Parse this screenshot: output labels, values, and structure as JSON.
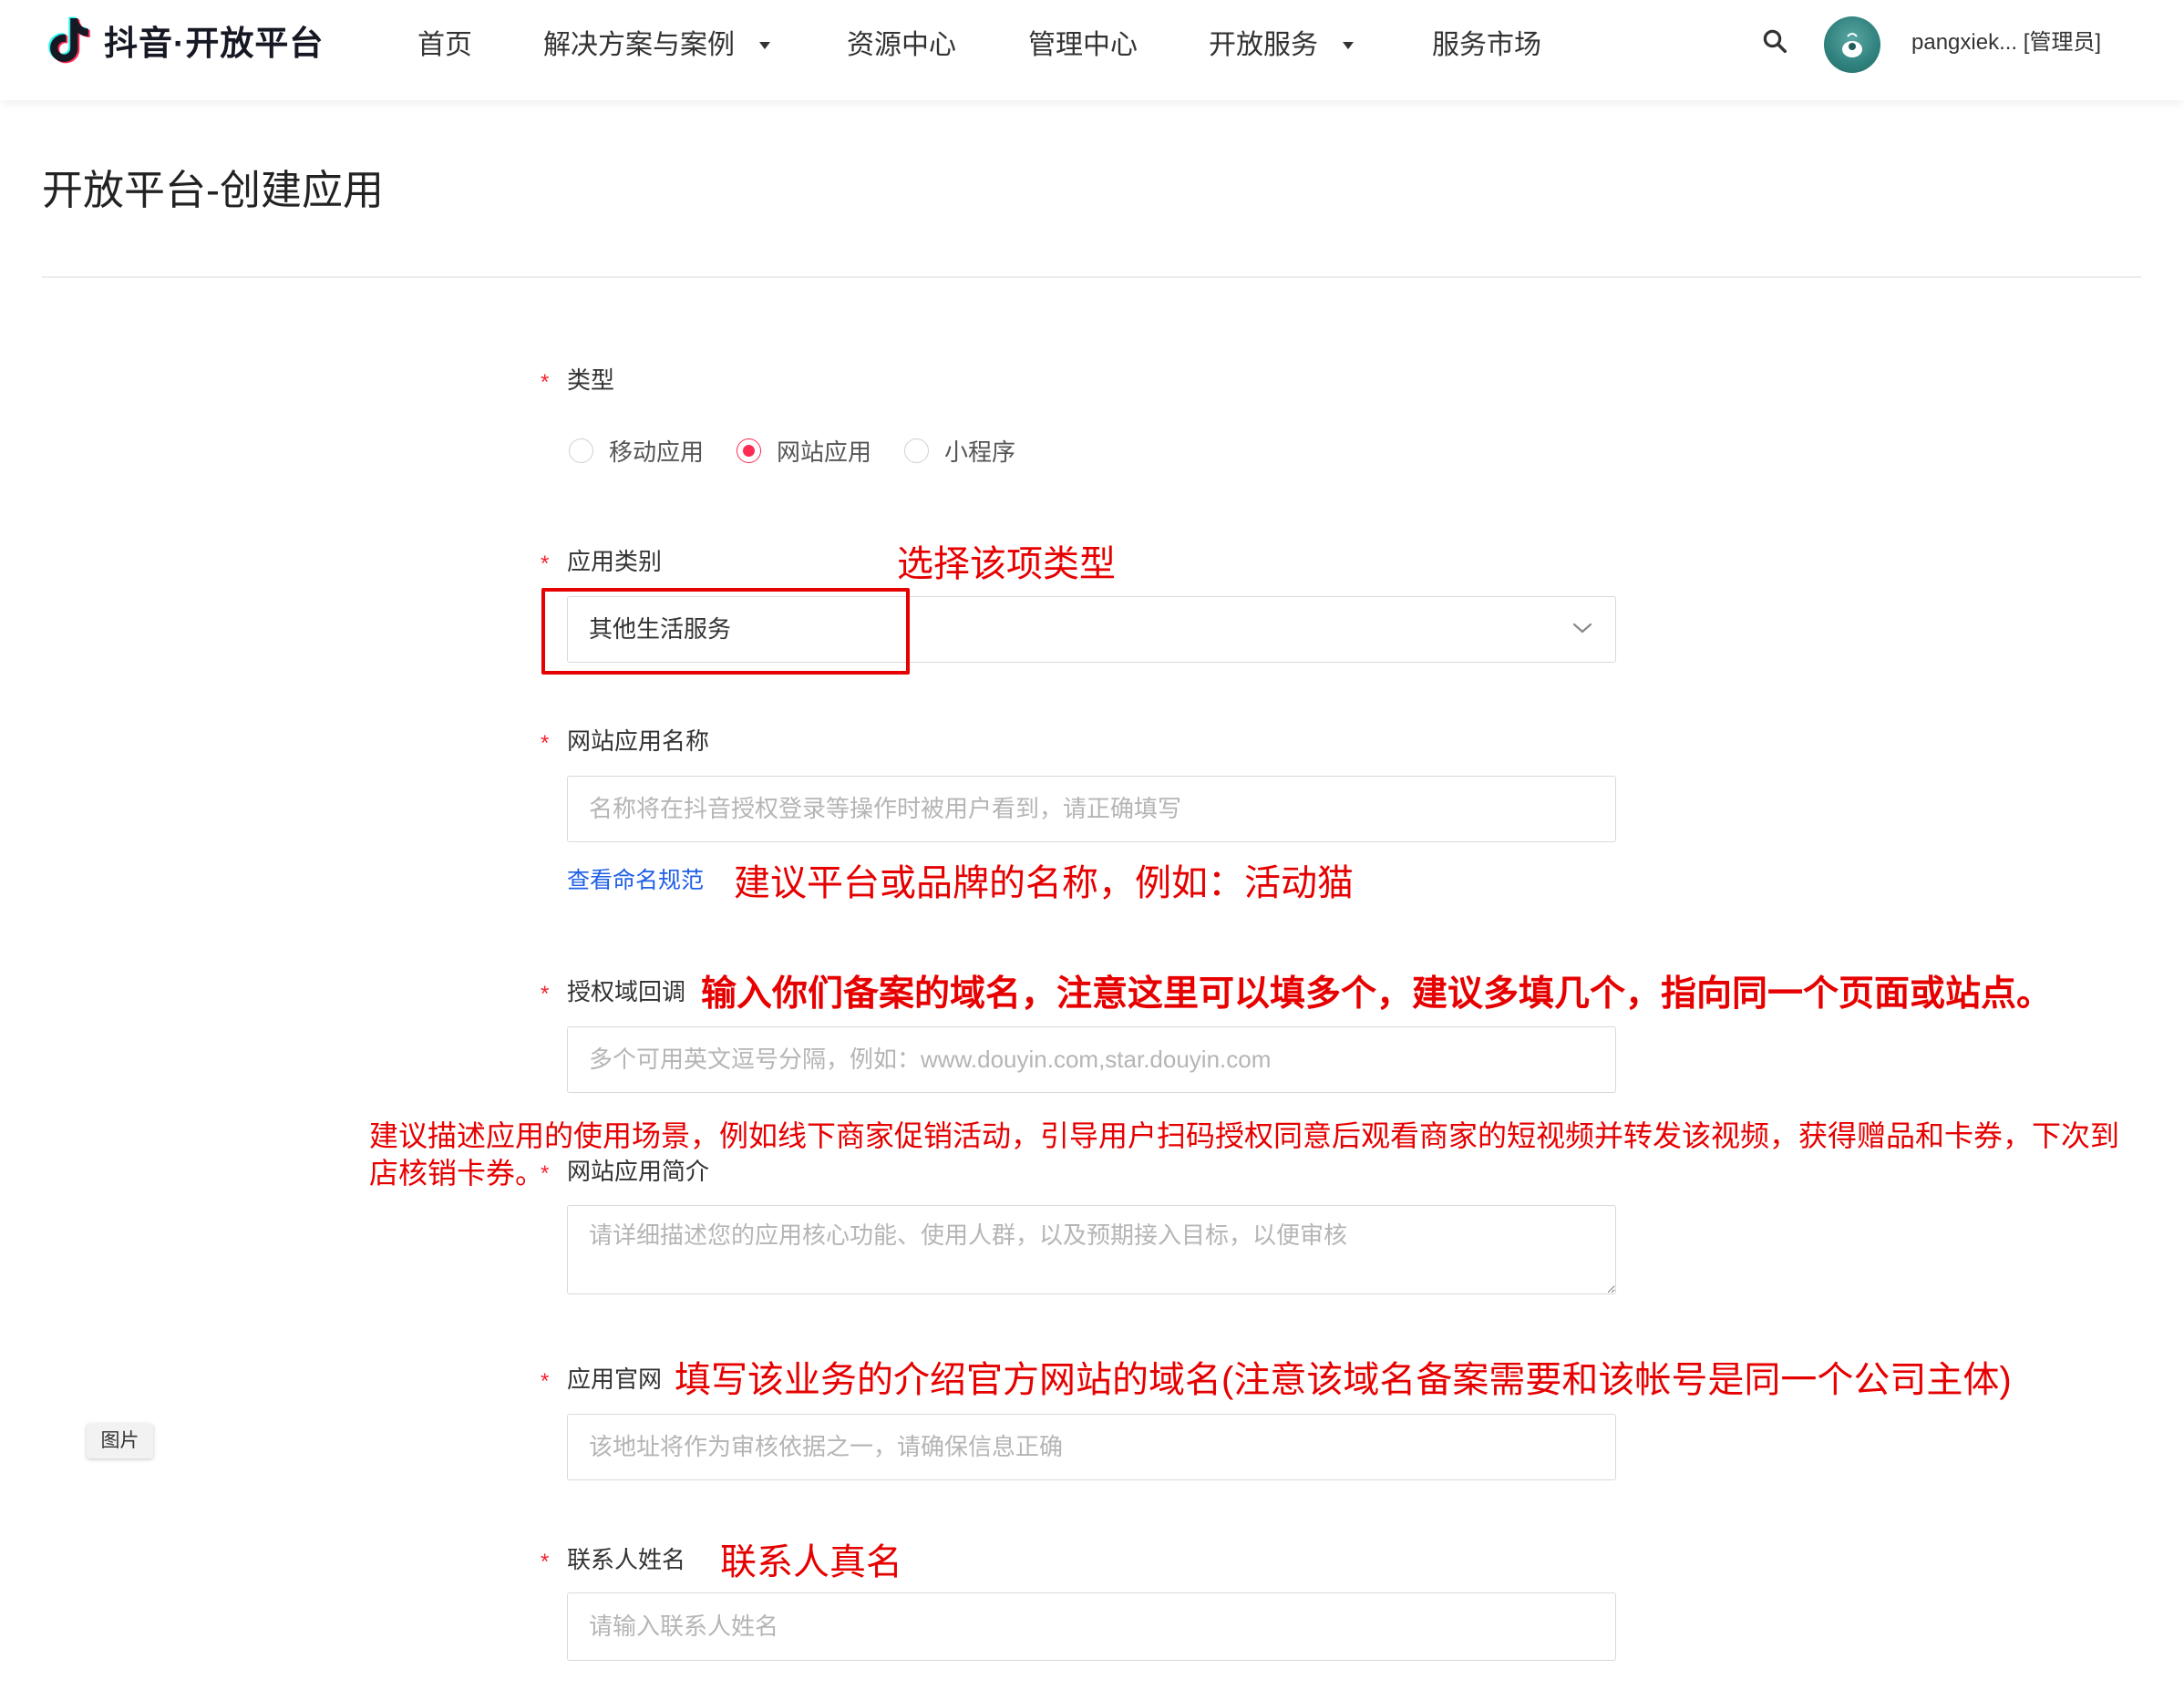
{
  "header": {
    "brand": "抖音·开放平台",
    "nav": [
      {
        "label": "首页"
      },
      {
        "label": "解决方案与案例"
      },
      {
        "label": "资源中心"
      },
      {
        "label": "管理中心"
      },
      {
        "label": "开放服务"
      },
      {
        "label": "服务市场"
      }
    ],
    "user": {
      "name": "pangxiek... [管理员]"
    }
  },
  "page": {
    "title": "开放平台-创建应用"
  },
  "form": {
    "required_mark": "*",
    "type": {
      "label": "类型",
      "options": [
        {
          "label": "移动应用",
          "selected": false
        },
        {
          "label": "网站应用",
          "selected": true
        },
        {
          "label": "小程序",
          "selected": false
        }
      ]
    },
    "category": {
      "label": "应用类别",
      "value": "其他生活服务"
    },
    "app_name": {
      "label": "网站应用名称",
      "placeholder": "名称将在抖音授权登录等操作时被用户看到，请正确填写",
      "link": "查看命名规范"
    },
    "auth_domain": {
      "label": "授权域回调",
      "placeholder": "多个可用英文逗号分隔，例如：www.douyin.com,star.douyin.com"
    },
    "intro": {
      "label": "网站应用简介",
      "placeholder": "请详细描述您的应用核心功能、使用人群，以及预期接入目标，以便审核"
    },
    "website": {
      "label": "应用官网",
      "placeholder": "该地址将作为审核依据之一，请确保信息正确"
    },
    "contact": {
      "label": "联系人姓名",
      "placeholder": "请输入联系人姓名"
    }
  },
  "annotations": {
    "category_hint": "选择该项类型",
    "app_name_hint": "建议平台或品牌的名称，例如：活动猫",
    "auth_domain_hint": "输入你们备案的域名，注意这里可以填多个，建议多填几个，指向同一个页面或站点。",
    "intro_hint": "建议描述应用的使用场景，例如线下商家促销活动，引导用户扫码授权同意后观看商家的短视频并转发该视频，获得赠品和卡券，下次到店核销卡券。",
    "website_hint": "填写该业务的介绍官方网站的域名(注意该域名备案需要和该帐号是同一个公司主体)",
    "contact_hint": "联系人真名"
  },
  "image_badge": "图片",
  "icons": {
    "logo": "douyin-logo-icon",
    "nav_dropdown": "caret-down-icon",
    "search": "search-icon",
    "avatar": "avatar",
    "select": "chevron-down-icon"
  },
  "colors": {
    "radio_selected": "#fe2c55",
    "required_mark": "#f5222d",
    "annotation_red": "#e60000",
    "link_blue": "#1f5fe6",
    "border": "#d9d9d9"
  }
}
